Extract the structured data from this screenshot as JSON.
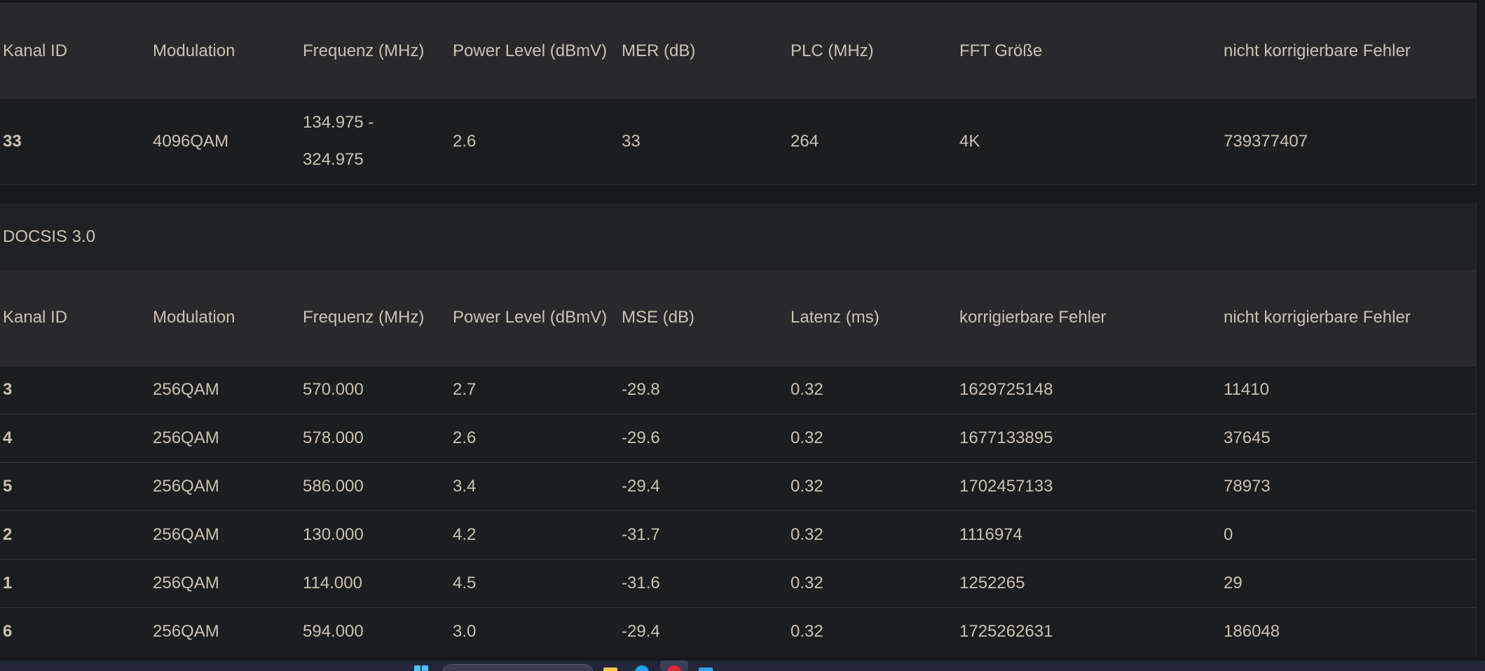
{
  "ofdm": {
    "headers": [
      "Kanal ID",
      "Modulation",
      "Frequenz (MHz)",
      "Power Level (dBmV)",
      "MER (dB)",
      "PLC (MHz)",
      "FFT Größe",
      "nicht korrigierbare Fehler"
    ],
    "rows": [
      [
        "33",
        "4096QAM",
        "134.975 - 324.975",
        "2.6",
        "33",
        "264",
        "4K",
        "739377407"
      ]
    ]
  },
  "docsis30": {
    "title": "DOCSIS 3.0",
    "headers": [
      "Kanal ID",
      "Modulation",
      "Frequenz (MHz)",
      "Power Level (dBmV)",
      "MSE (dB)",
      "Latenz (ms)",
      "korrigierbare Fehler",
      "nicht korrigierbare Fehler"
    ],
    "rows": [
      [
        "3",
        "256QAM",
        "570.000",
        "2.7",
        "-29.8",
        "0.32",
        "1629725148",
        "11410"
      ],
      [
        "4",
        "256QAM",
        "578.000",
        "2.6",
        "-29.6",
        "0.32",
        "1677133895",
        "37645"
      ],
      [
        "5",
        "256QAM",
        "586.000",
        "3.4",
        "-29.4",
        "0.32",
        "1702457133",
        "78973"
      ],
      [
        "2",
        "256QAM",
        "130.000",
        "4.2",
        "-31.7",
        "0.32",
        "1116974",
        "0"
      ],
      [
        "1",
        "256QAM",
        "114.000",
        "4.5",
        "-31.6",
        "0.32",
        "1252265",
        "29"
      ],
      [
        "6",
        "256QAM",
        "594.000",
        "3.0",
        "-29.4",
        "0.32",
        "1725262631",
        "186048"
      ]
    ]
  },
  "taskbar": {
    "icons": [
      "windows-start-icon",
      "search-box",
      "file-explorer-icon",
      "edge-browser-icon",
      "opera-browser-icon",
      "mail-icon"
    ]
  },
  "colors": {
    "background": "#17181a",
    "header_row": "#29292b",
    "text": "#c9c2b6"
  }
}
